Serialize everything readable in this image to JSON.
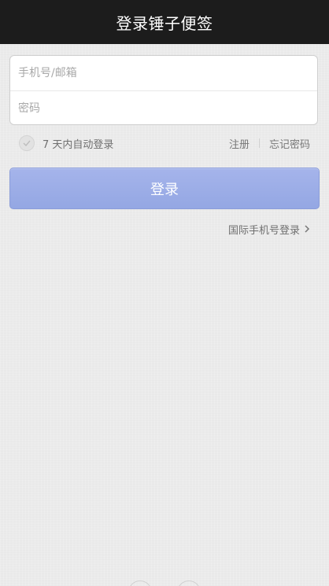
{
  "header": {
    "title": "登录锤子便签"
  },
  "form": {
    "account_placeholder": "手机号/邮箱",
    "password_placeholder": "密码"
  },
  "options": {
    "remember_label": "7 天内自动登录",
    "register_label": "注册",
    "forgot_label": "忘记密码"
  },
  "login_button": {
    "label": "登录"
  },
  "intl_login": {
    "label": "国际手机号登录"
  },
  "colors": {
    "header_bg": "#1c1c1c",
    "button_bg": "#9aabe6",
    "page_bg": "#ebebeb"
  },
  "icons": [
    "check-icon",
    "chevron-right-icon"
  ]
}
